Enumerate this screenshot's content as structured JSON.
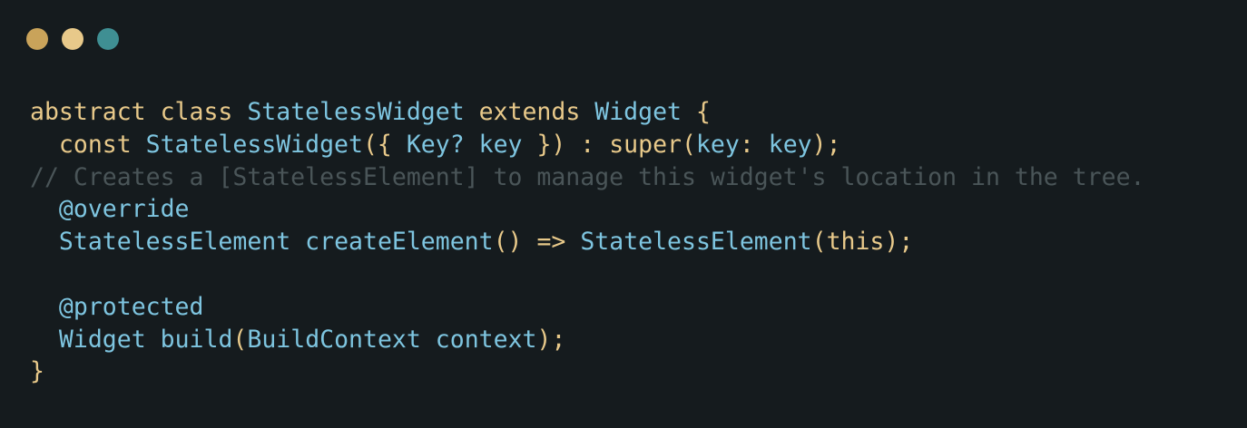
{
  "window": {
    "buttons": [
      {
        "name": "close",
        "color": "#c9a35a"
      },
      {
        "name": "minimize",
        "color": "#e8c98a"
      },
      {
        "name": "maximize",
        "color": "#3f8f93"
      }
    ]
  },
  "colors": {
    "background": "#151b1e",
    "keyword": "#e8c98a",
    "type": "#7ec5e0",
    "comment": "#4a5558"
  },
  "code": {
    "lines": [
      [
        {
          "text": "abstract class ",
          "kind": "keyword"
        },
        {
          "text": "StatelessWidget",
          "kind": "type"
        },
        {
          "text": " extends ",
          "kind": "keyword"
        },
        {
          "text": "Widget",
          "kind": "type"
        },
        {
          "text": " {",
          "kind": "punct"
        }
      ],
      [
        {
          "text": "  const ",
          "kind": "keyword"
        },
        {
          "text": "StatelessWidget",
          "kind": "type"
        },
        {
          "text": "({ ",
          "kind": "punct"
        },
        {
          "text": "Key? key",
          "kind": "type"
        },
        {
          "text": " }) : super(",
          "kind": "plain"
        },
        {
          "text": "key",
          "kind": "param"
        },
        {
          "text": ": ",
          "kind": "punct"
        },
        {
          "text": "key",
          "kind": "param"
        },
        {
          "text": ");",
          "kind": "punct"
        }
      ],
      [
        {
          "text": "// Creates a [StatelessElement] to manage this widget's location in the tree.",
          "kind": "comment"
        }
      ],
      [
        {
          "text": "  ",
          "kind": "plain"
        },
        {
          "text": "@override",
          "kind": "annotation"
        }
      ],
      [
        {
          "text": "  ",
          "kind": "plain"
        },
        {
          "text": "StatelessElement",
          "kind": "type"
        },
        {
          "text": " ",
          "kind": "plain"
        },
        {
          "text": "createElement",
          "kind": "type"
        },
        {
          "text": "() => ",
          "kind": "punct"
        },
        {
          "text": "StatelessElement",
          "kind": "type"
        },
        {
          "text": "(this);",
          "kind": "plain"
        }
      ],
      [
        {
          "text": "",
          "kind": "plain"
        }
      ],
      [
        {
          "text": "  ",
          "kind": "plain"
        },
        {
          "text": "@protected",
          "kind": "annotation"
        }
      ],
      [
        {
          "text": "  ",
          "kind": "plain"
        },
        {
          "text": "Widget",
          "kind": "type"
        },
        {
          "text": " ",
          "kind": "plain"
        },
        {
          "text": "build",
          "kind": "type"
        },
        {
          "text": "(",
          "kind": "punct"
        },
        {
          "text": "BuildContext",
          "kind": "type"
        },
        {
          "text": " ",
          "kind": "plain"
        },
        {
          "text": "context",
          "kind": "type"
        },
        {
          "text": ");",
          "kind": "punct"
        }
      ],
      [
        {
          "text": "}",
          "kind": "punct"
        }
      ]
    ]
  }
}
